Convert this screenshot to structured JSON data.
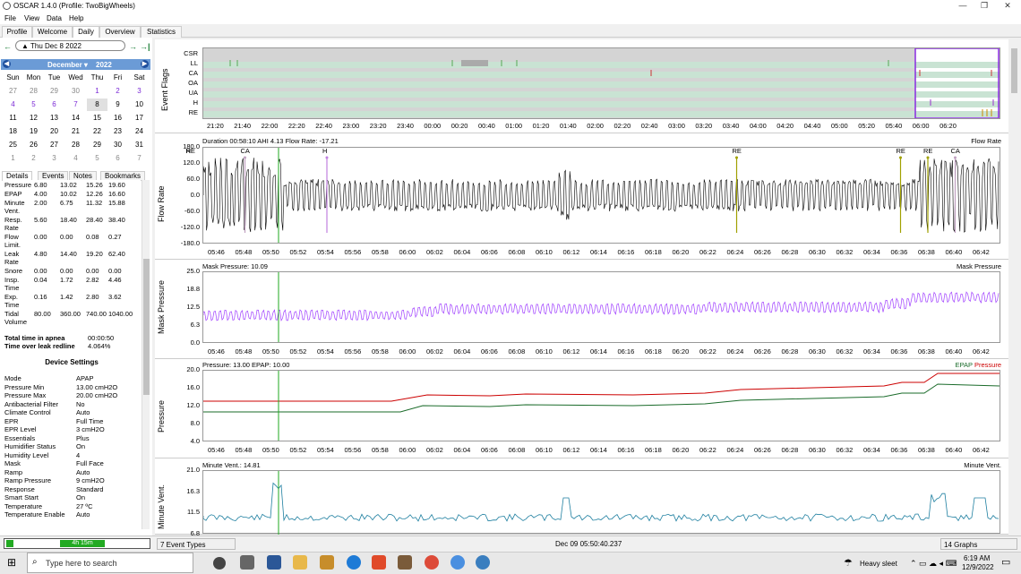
{
  "window": {
    "title": "OSCAR 1.4.0 (Profile: TwoBigWheels)",
    "min": "—",
    "max": "❐",
    "close": "✕"
  },
  "menu": [
    "File",
    "View",
    "Data",
    "Help"
  ],
  "tabs": [
    "Profile",
    "Welcome",
    "Daily",
    "Overview",
    "Statistics"
  ],
  "active_tab": "Daily",
  "date_nav": {
    "date": "Thu Dec 8 2022",
    "prev": "←",
    "next": "→",
    "last": "→|"
  },
  "calendar": {
    "month": "December ▾",
    "year": "2022",
    "weekdays": [
      "Sun",
      "Mon",
      "Tue",
      "Wed",
      "Thu",
      "Fri",
      "Sat"
    ],
    "weeks": [
      [
        "27",
        "28",
        "29",
        "30",
        "1",
        "2",
        "3"
      ],
      [
        "4",
        "5",
        "6",
        "7",
        "8",
        "9",
        "10"
      ],
      [
        "11",
        "12",
        "13",
        "14",
        "15",
        "16",
        "17"
      ],
      [
        "18",
        "19",
        "20",
        "21",
        "22",
        "23",
        "24"
      ],
      [
        "25",
        "26",
        "27",
        "28",
        "29",
        "30",
        "31"
      ],
      [
        "1",
        "2",
        "3",
        "4",
        "5",
        "6",
        "7"
      ]
    ],
    "selected": "8"
  },
  "detail_tabs": [
    "Details",
    "Events",
    "Notes",
    "Bookmarks"
  ],
  "stats": [
    {
      "name": "Pressure",
      "v": [
        "6.80",
        "13.02",
        "15.26",
        "19.60"
      ]
    },
    {
      "name": "EPAP",
      "v": [
        "4.00",
        "10.02",
        "12.26",
        "16.60"
      ]
    },
    {
      "name": "Minute Vent.",
      "v": [
        "2.00",
        "6.75",
        "11.32",
        "15.88"
      ]
    },
    {
      "name": "Resp. Rate",
      "v": [
        "5.60",
        "18.40",
        "28.40",
        "38.40"
      ]
    },
    {
      "name": "Flow Limit.",
      "v": [
        "0.00",
        "0.00",
        "0.08",
        "0.27"
      ]
    },
    {
      "name": "Leak Rate",
      "v": [
        "4.80",
        "14.40",
        "19.20",
        "62.40"
      ]
    },
    {
      "name": "Snore",
      "v": [
        "0.00",
        "0.00",
        "0.00",
        "0.00"
      ]
    },
    {
      "name": "Insp. Time",
      "v": [
        "0.04",
        "1.72",
        "2.82",
        "4.46"
      ]
    },
    {
      "name": "Exp. Time",
      "v": [
        "0.16",
        "1.42",
        "2.80",
        "3.62"
      ]
    },
    {
      "name": "Tidal Volume",
      "v": [
        "80.00",
        "360.00",
        "740.00",
        "1040.00"
      ]
    }
  ],
  "apnea": {
    "label": "Total time in apnea",
    "value": "00:00:50"
  },
  "leak": {
    "label": "Time over leak redline",
    "value": "4.064%"
  },
  "device_title": "Device Settings",
  "device": [
    [
      "Mode",
      "APAP"
    ],
    [
      "Pressure Min",
      "13.00 cmH2O"
    ],
    [
      "Pressure Max",
      "20.00 cmH2O"
    ],
    [
      "Antibacterial Filter",
      "No"
    ],
    [
      "Climate Control",
      "Auto"
    ],
    [
      "EPR",
      "Full Time"
    ],
    [
      "EPR Level",
      "3 cmH2O"
    ],
    [
      "Essentials",
      "Plus"
    ],
    [
      "Humidifier Status",
      "On"
    ],
    [
      "Humidity Level",
      "4"
    ],
    [
      "Mask",
      "Full Face"
    ],
    [
      "Ramp",
      "Auto"
    ],
    [
      "Ramp Pressure",
      "9 cmH2O"
    ],
    [
      "Response",
      "Standard"
    ],
    [
      "Smart Start",
      "On"
    ],
    [
      "Temperature",
      "27 ºC"
    ],
    [
      "Temperature Enable",
      "Auto"
    ]
  ],
  "bottom": {
    "duration": "4h 15m",
    "events": "7 Event Types",
    "timestamp": "Dec 09 05:50:40.237",
    "graphs": "14 Graphs"
  },
  "event_flags": {
    "label": "Event Flags",
    "rows": [
      "CSR",
      "LL",
      "CA",
      "OA",
      "UA",
      "H",
      "RE"
    ],
    "xticks": [
      "21:20",
      "21:40",
      "22:00",
      "22:20",
      "22:40",
      "23:00",
      "23:20",
      "23:40",
      "00:00",
      "00:20",
      "00:40",
      "01:00",
      "01:20",
      "01:40",
      "02:00",
      "02:20",
      "02:40",
      "03:00",
      "03:20",
      "03:40",
      "04:00",
      "04:20",
      "04:40",
      "05:00",
      "05:20",
      "05:40",
      "06:00",
      "06:20"
    ]
  },
  "xticks": [
    "05:46",
    "05:48",
    "05:50",
    "05:52",
    "05:54",
    "05:56",
    "05:58",
    "06:00",
    "06:02",
    "06:04",
    "06:06",
    "06:08",
    "06:10",
    "06:12",
    "06:14",
    "06:16",
    "06:18",
    "06:20",
    "06:22",
    "06:24",
    "06:26",
    "06:28",
    "06:30",
    "06:32",
    "06:34",
    "06:36",
    "06:38",
    "06:40",
    "06:42"
  ],
  "flow": {
    "label": "Flow Rate",
    "title": "Duration 00:58:10 AHI 4.13 Flow Rate: -17.21",
    "legend": "Flow Rate",
    "yticks": [
      "180.0",
      "120.0",
      "60.0",
      "0.0",
      "-60.0",
      "-120.0",
      "-180.0"
    ],
    "events": [
      {
        "t": "CA",
        "x": "05:48"
      },
      {
        "t": "H",
        "x": "05:54"
      },
      {
        "t": "RE",
        "x": "06:24"
      },
      {
        "t": "RE",
        "x": "06:33"
      },
      {
        "t": "RE",
        "x": "06:36"
      },
      {
        "t": "RE",
        "x": "06:38"
      },
      {
        "t": "CA",
        "x": "06:40"
      },
      {
        "t": "H",
        "x": "06:41"
      }
    ]
  },
  "mask": {
    "label": "Mask Pressure",
    "title": "Mask Pressure: 10.09",
    "legend": "Mask Pressure",
    "yticks": [
      "25.0",
      "18.8",
      "12.5",
      "6.3",
      "0.0"
    ]
  },
  "pressure": {
    "label": "Pressure",
    "title": "Pressure: 13.00 EPAP: 10.00",
    "legend1": "EPAP",
    "legend2": "Pressure",
    "yticks": [
      "20.0",
      "16.0",
      "12.0",
      "8.0",
      "4.0"
    ]
  },
  "minvent": {
    "label": "Minute Vent.",
    "title": "Minute Vent.: 14.81",
    "legend": "Minute Vent.",
    "yticks": [
      "21.0",
      "16.3",
      "11.5",
      "6.8"
    ]
  },
  "taskbar": {
    "search": "Type here to search",
    "weather": "Heavy sleet",
    "time": "6:19 AM",
    "date": "12/9/2022"
  }
}
